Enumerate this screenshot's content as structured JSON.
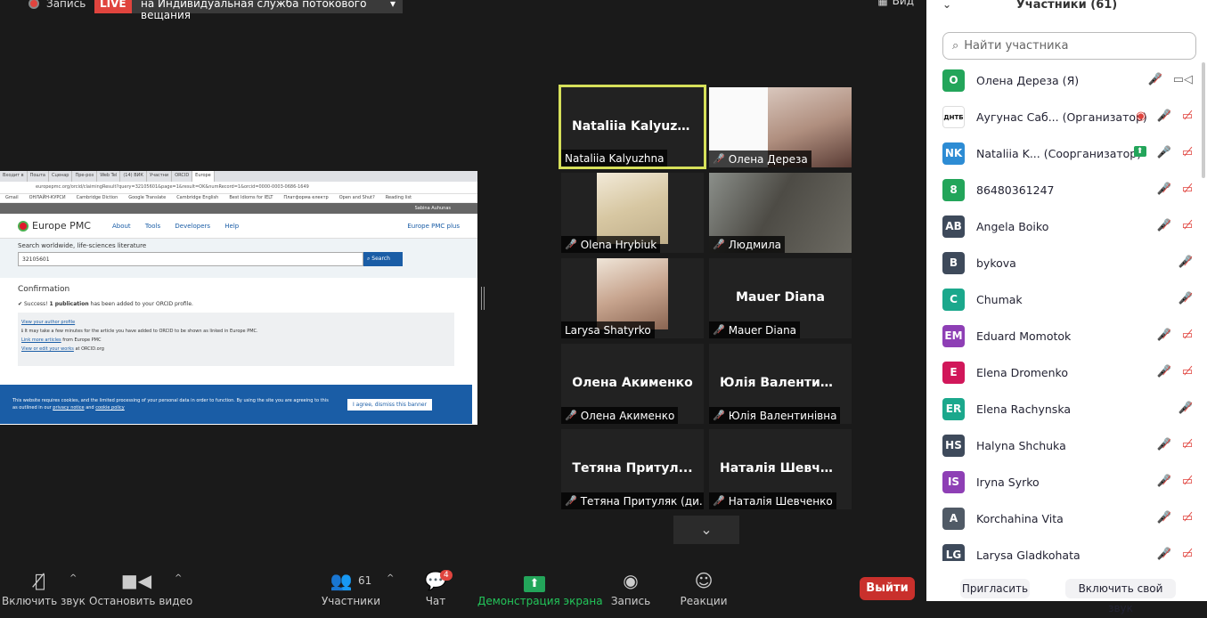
{
  "topbar": {
    "record_label": "Запись",
    "live_label": "LIVE",
    "stream_label": "на Индивидуальная служба потокового вещания",
    "view_label": "Вид"
  },
  "share": {
    "tabs": [
      "Входит в",
      "Пошта",
      "Сценар",
      "Пре-роз",
      "Web Tel",
      "(14) ВИК",
      "Участни",
      "ORCID",
      "Europe"
    ],
    "url": "europepmc.org/orcid/claimingResult?query=32105601&page=1&result=OK&numRecord=1&orcid=0000-0003-0686-1649",
    "bookmarks": [
      "Gmail",
      "ОНЛАЙН-КУРСИ",
      "Cambridge Diction",
      "Google Translate",
      "Cambridge English",
      "Best Idioms for IELT",
      "Платформа електр",
      "Open and Shut?",
      "Reading list"
    ],
    "user": "Sabina Auhunas",
    "logo": "Europe PMC",
    "nav": [
      "About",
      "Tools",
      "Developers",
      "Help"
    ],
    "plus": "Europe PMC plus",
    "search_heading": "Search worldwide, life-sciences literature",
    "search_value": "32105601",
    "search_btn": "Search",
    "confirm_title": "Confirmation",
    "success_pre": "Success!",
    "success_bold": "1 publication",
    "success_post": "has been added to your ORCID profile.",
    "link_author": "View your author profile",
    "note": "It may take a few minutes for the article you have added to ORCID to be shown as linked in Europe PMC.",
    "link_more": "Link more articles",
    "link_more_post": "from Europe PMC",
    "link_view": "View or edit your works",
    "link_view_post": "at ORCID.org",
    "cookie_text": "This website requires cookies, and the limited processing of your personal data in order to function. By using the site you are agreeing to this as outlined in our",
    "cookie_privacy": "privacy notice",
    "cookie_and": "and",
    "cookie_policy": "cookie policy",
    "cookie_btn": "I agree, dismiss this banner"
  },
  "tiles": [
    {
      "big": "Nataliia  Kalyuzh...",
      "label": "Nataliia Kalyuzhna"
    },
    {
      "label": "Олена Дереза"
    },
    {
      "label": "Olena Hrybiuk"
    },
    {
      "label": "Людмила"
    },
    {
      "label": "Larysa Shatyrko"
    },
    {
      "big": "Mauer Diana",
      "label": "Mauer Diana"
    },
    {
      "big": "Олена  Акименко",
      "label": "Олена  Акименко"
    },
    {
      "big": "Юлія  Валентині...",
      "label": "Юлія Валентинівна"
    },
    {
      "big": "Тетяна  Притул...",
      "label": "Тетяна Притуляк (ди..."
    },
    {
      "big": "Наталія  Шевче...",
      "label": "Наталія Шевченко"
    }
  ],
  "toolbar": {
    "mic": "Включить звук",
    "video": "Остановить видео",
    "participants_count": "61",
    "participants": "Участники",
    "chat": "Чат",
    "chat_badge": "4",
    "share": "Демонстрация экрана",
    "record": "Запись",
    "reactions": "Реакции",
    "leave": "Выйти"
  },
  "panel": {
    "title": "Участники (61)",
    "search_placeholder": "Найти участника",
    "participants": [
      {
        "initials": "O",
        "color": "#23a55a",
        "name": "Олена Дереза (Я)"
      },
      {
        "initials": "ДНТБ",
        "color": "#ffffff",
        "name": "Аугунас Саб... (Организатор)"
      },
      {
        "initials": "NK",
        "color": "#2d8cd4",
        "name": "Nataliia K... (Соорганизатор)"
      },
      {
        "initials": "8",
        "color": "#23a55a",
        "name": "86480361247"
      },
      {
        "initials": "AB",
        "color": "#3e4a5b",
        "name": "Angela Boiko"
      },
      {
        "initials": "B",
        "color": "#3e4a5b",
        "name": "bykova"
      },
      {
        "initials": "C",
        "color": "#1ba88c",
        "name": "Chumak"
      },
      {
        "initials": "EM",
        "color": "#8e3fb5",
        "name": "Eduard Momotok"
      },
      {
        "initials": "E",
        "color": "#d1175a",
        "name": "Elena Dromenko"
      },
      {
        "initials": "ER",
        "color": "#1ba88c",
        "name": "Elena Rachynska"
      },
      {
        "initials": "HS",
        "color": "#3e4a5b",
        "name": "Halyna Shchuka"
      },
      {
        "initials": "IS",
        "color": "#8e3fb5",
        "name": "Iryna Syrko"
      },
      {
        "initials": "A",
        "color": "#505a66",
        "name": "Korchahina Vita"
      },
      {
        "initials": "LG",
        "color": "#3e4a5b",
        "name": "Larysa Gladkohata"
      }
    ],
    "invite": "Пригласить",
    "unmute_self": "Включить свой звук"
  }
}
